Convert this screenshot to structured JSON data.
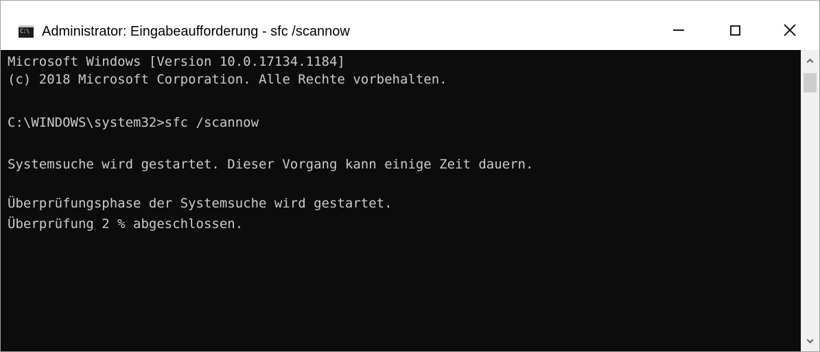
{
  "window": {
    "title": "Administrator: Eingabeaufforderung - sfc  /scannow",
    "icon": "cmd-console-icon",
    "icon_glyph": "C:\\",
    "controls": {
      "minimize_icon": "minimize-icon",
      "maximize_icon": "maximize-icon",
      "close_icon": "close-icon",
      "close_glyph": "✕"
    }
  },
  "console": {
    "background": "#0c0c0c",
    "foreground": "#cccccc",
    "lines": [
      "Microsoft Windows [Version 10.0.17134.1184]",
      "(c) 2018 Microsoft Corporation. Alle Rechte vorbehalten.",
      "",
      "C:\\WINDOWS\\system32>sfc /scannow",
      "",
      "Systemsuche wird gestartet. Dieser Vorgang kann einige Zeit dauern.",
      "",
      "Überprüfungsphase der Systemsuche wird gestartet.",
      "Überprüfung 2 % abgeschlossen."
    ]
  },
  "scrollbar": {
    "up_icon": "chevron-up-icon",
    "down_icon": "chevron-down-icon"
  }
}
